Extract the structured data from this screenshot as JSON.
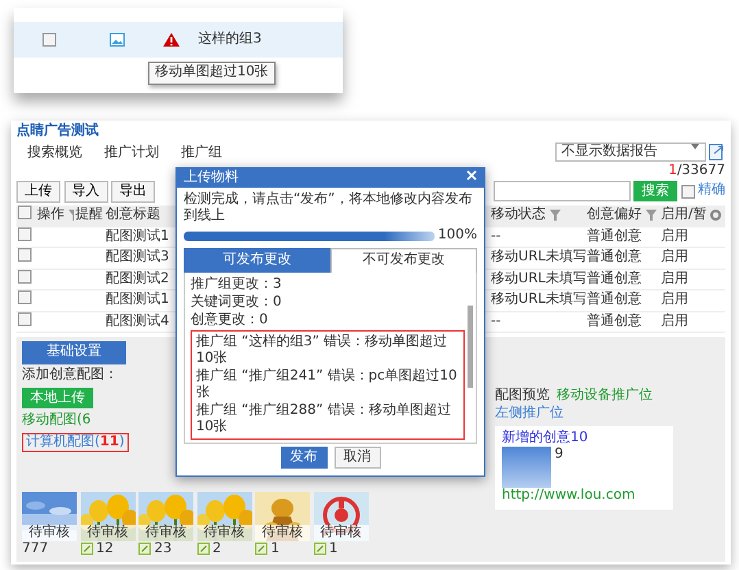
{
  "callout": {
    "rows": [
      {
        "checked": false,
        "title": "这样的组3",
        "warning": true
      }
    ],
    "tooltip": "移动单图超过10张"
  },
  "app": {
    "title": "点睛广告测试",
    "tabs": [
      {
        "label": "搜索概览",
        "selected": false
      },
      {
        "label": "推广计划",
        "selected": false
      },
      {
        "label": "推广组",
        "selected": false
      }
    ],
    "report_select": "不显示数据报告",
    "page_counter": {
      "current": "1",
      "total": "/33677"
    },
    "toolbar_buttons": [
      "上传",
      "导入",
      "导出"
    ],
    "search_button": "搜索",
    "exact": {
      "label": "精确",
      "checked": false
    },
    "table": {
      "select_all": {
        "checked": false
      },
      "columns": [
        "操作",
        "提醒",
        "创意标题",
        "移动状态",
        "创意偏好",
        "启用/暂"
      ],
      "rows": [
        {
          "checked": false,
          "title": "配图测试1",
          "mobile_status": "--",
          "preference": "普通创意",
          "enabled": "启用"
        },
        {
          "checked": false,
          "title": "配图测试3",
          "mobile_status": "移动URL未填写",
          "preference": "普通创意",
          "enabled": "启用"
        },
        {
          "checked": false,
          "title": "配图测试2",
          "mobile_status": "移动URL未填写",
          "preference": "普通创意",
          "enabled": "启用"
        },
        {
          "checked": false,
          "title": "配图测试1",
          "mobile_status": "移动URL未填写",
          "preference": "普通创意",
          "enabled": "启用"
        },
        {
          "checked": false,
          "title": "配图测试4",
          "mobile_status": "--",
          "preference": "普通创意",
          "enabled": "启用"
        }
      ]
    },
    "bottom_panel": {
      "tab": "基础设置",
      "add_label": "添加创意配图：",
      "upload_button": "本地上传",
      "mobile_link": "移动配图(6",
      "pc_link": "计算机配图(**11**)",
      "thumbnails": [
        {
          "status": "待审核",
          "count": "777",
          "editable": false
        },
        {
          "status": "待审核",
          "count": "12",
          "editable": true
        },
        {
          "status": "待审核",
          "count": "23",
          "editable": true
        },
        {
          "status": "待审核",
          "count": "2",
          "editable": true
        },
        {
          "status": "待审核",
          "count": "1",
          "editable": true
        },
        {
          "status": "待审核",
          "count": "1",
          "editable": true
        }
      ]
    },
    "preview": {
      "label": "配图预览",
      "tabs": [
        {
          "label": "移动设备推广位",
          "selected": true
        },
        {
          "label": "左侧推广位",
          "selected": false
        }
      ],
      "title": "新增的创意10",
      "count": "9",
      "url": "http://www.lou.com"
    }
  },
  "modal": {
    "title": "上传物料",
    "message": "检测完成，请点击“发布”，将本地修改内容发布到线上",
    "progress": {
      "level": 1,
      "reading": "100%"
    },
    "tabs": [
      {
        "label": "可发布更改",
        "selected": false
      },
      {
        "label": "不可发布更改",
        "selected": true
      }
    ],
    "summary": [
      "推广组更改：3",
      "关键词更改：0",
      "创意更改：0"
    ],
    "errors": [
      "推广组 “这样的组3” 错误：移动单图超过10张",
      "推广组 “推广组241” 错误：pc单图超过10张",
      "推广组 “推广组288” 错误：移动单图超过10张"
    ],
    "buttons": [
      {
        "label": "发布",
        "kind": "primary"
      },
      {
        "label": "取消",
        "kind": "secondary"
      }
    ]
  }
}
